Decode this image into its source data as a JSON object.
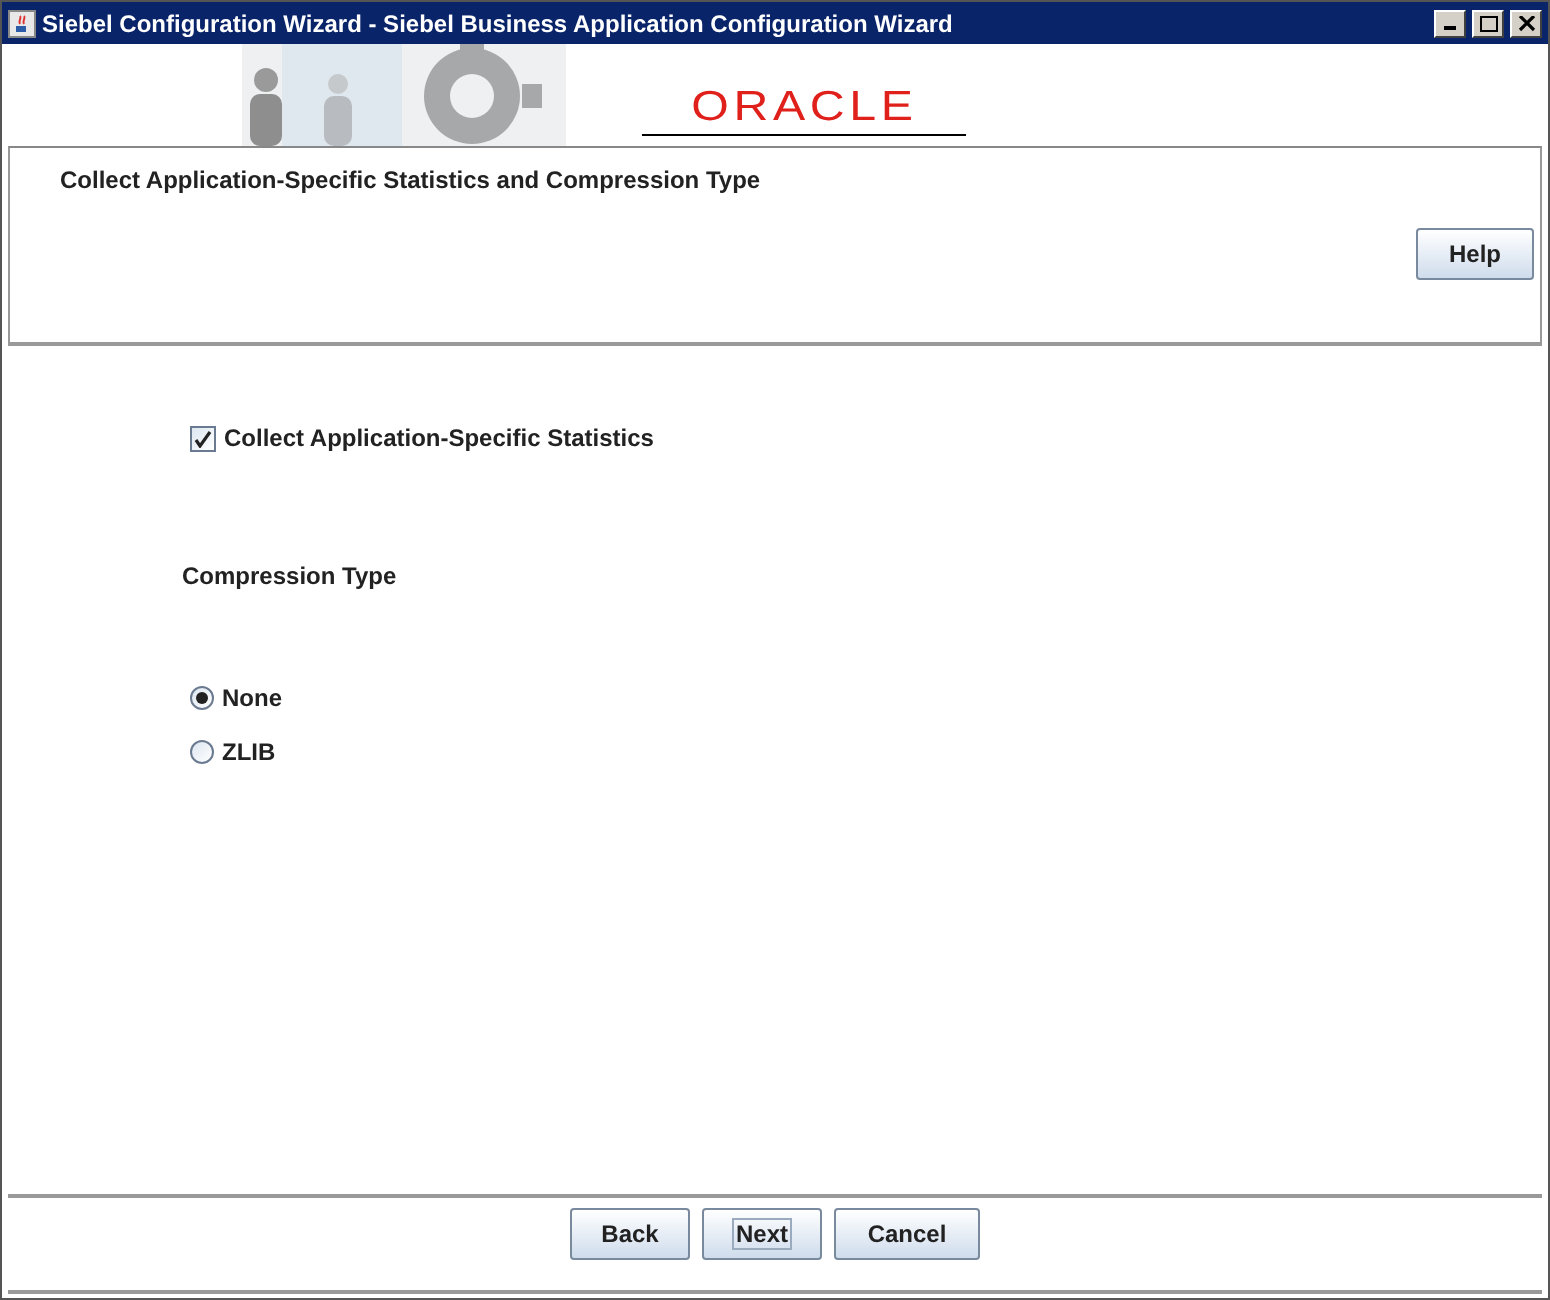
{
  "window": {
    "title": "Siebel Configuration Wizard - Siebel Business Application Configuration Wizard"
  },
  "banner": {
    "logo": "ORACLE"
  },
  "header": {
    "title": "Collect Application-Specific Statistics and Compression Type",
    "help_button": "Help"
  },
  "collect_stats": {
    "label": "Collect Application-Specific Statistics",
    "checked": true
  },
  "compression": {
    "label": "Compression Type",
    "options": [
      {
        "label": "None",
        "selected": true
      },
      {
        "label": "ZLIB",
        "selected": false
      }
    ]
  },
  "buttons": [
    {
      "label": "Back",
      "focused": false
    },
    {
      "label": "Next",
      "focused": true
    },
    {
      "label": "Cancel",
      "focused": false
    }
  ]
}
